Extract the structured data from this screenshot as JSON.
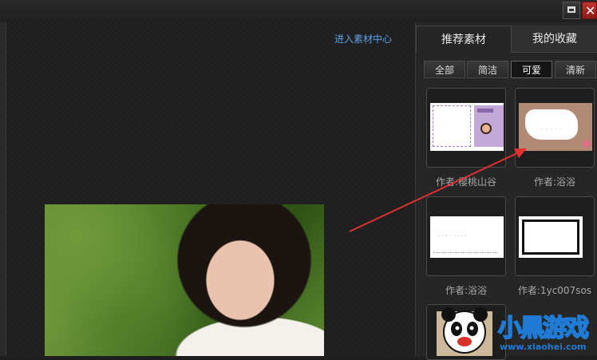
{
  "window": {
    "maximize_icon": "maximize-icon",
    "close_icon": "close-icon",
    "close_glyph": "✕"
  },
  "main": {
    "material_center_link": "进入素材中心"
  },
  "panel": {
    "tabs": [
      {
        "label": "推荐素材",
        "active": true
      },
      {
        "label": "我的收藏",
        "active": false
      }
    ],
    "filters": [
      {
        "label": "全部",
        "active": false
      },
      {
        "label": "简洁",
        "active": false
      },
      {
        "label": "可爱",
        "active": true
      },
      {
        "label": "清新",
        "active": false
      }
    ],
    "items": [
      {
        "caption": "作者:樱桃山谷"
      },
      {
        "caption": "作者:浴浴"
      },
      {
        "caption": "作者:浴浴"
      },
      {
        "caption": "作者:1yc007sos"
      }
    ]
  },
  "watermark": {
    "name": "小黑游戏",
    "url": "www.xiaohei.com"
  },
  "colors": {
    "link": "#5ea1e6",
    "arrow": "#e03030",
    "close_button": "#c0342e"
  }
}
